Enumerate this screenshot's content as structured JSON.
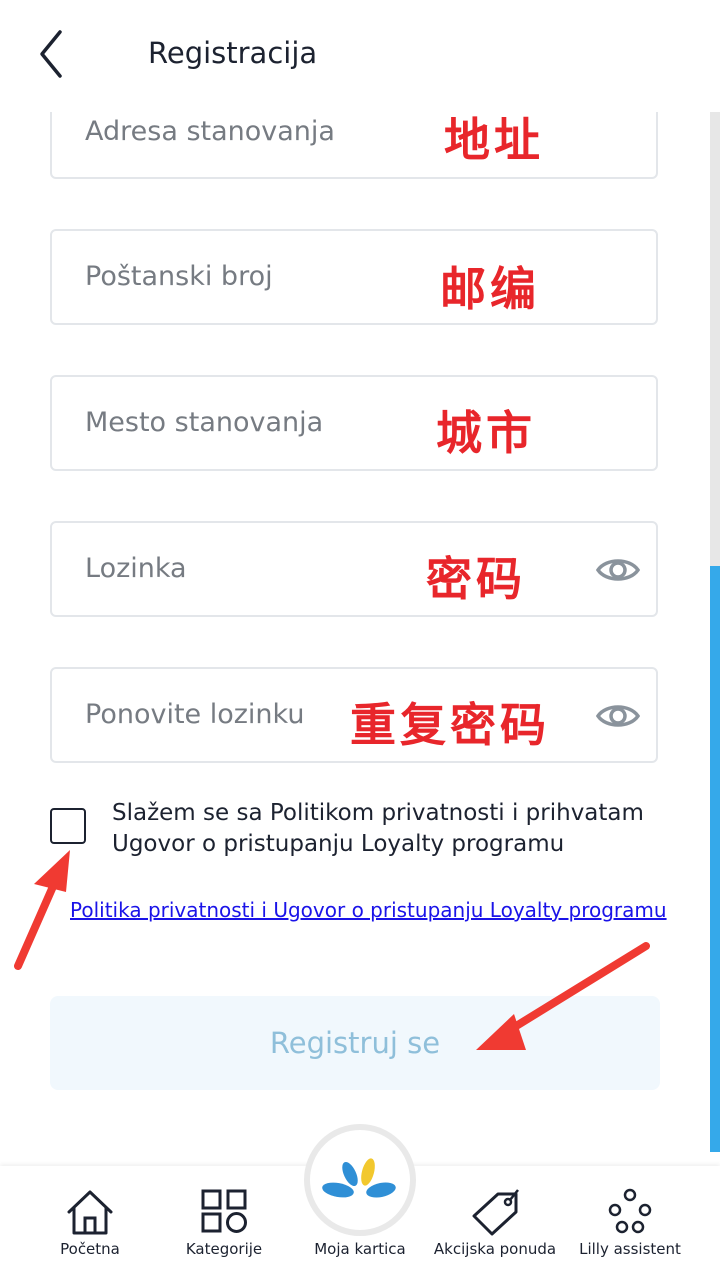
{
  "header": {
    "title": "Registracija",
    "back_icon": "chevron-left-icon"
  },
  "fields": [
    {
      "placeholder": "Adresa stanovanja",
      "note": "地址"
    },
    {
      "placeholder": "Poštanski broj",
      "note": "邮编"
    },
    {
      "placeholder": "Mesto stanovanja",
      "note": "城市"
    },
    {
      "placeholder": "Lozinka",
      "note": "密码",
      "icon": "eye-icon"
    },
    {
      "placeholder": "Ponovite lozinku",
      "note": "重复密码",
      "icon": "eye-icon"
    }
  ],
  "consent": {
    "text": "Slažem se sa Politikom privatnosti i prihvatam Ugovor o pristupanju Loyalty programu",
    "link": "Politika privatnosti i Ugovor o pristupanju Loyalty programu"
  },
  "submit_label": "Registruj se",
  "nav": {
    "items": [
      {
        "label": "Početna",
        "icon": "home-icon"
      },
      {
        "label": "Kategorije",
        "icon": "grid-icon"
      },
      {
        "label": "Moja kartica",
        "icon": "petals-logo-icon"
      },
      {
        "label": "Akcijska ponuda",
        "icon": "tag-icon"
      },
      {
        "label": "Lilly assistent",
        "icon": "molecule-icon"
      }
    ]
  },
  "colors": {
    "accent": "#35a9ea",
    "note_red": "#e8262b",
    "link": "#1a13e8",
    "submit_bg": "#f1f8fd",
    "submit_text": "#8fbfda"
  }
}
